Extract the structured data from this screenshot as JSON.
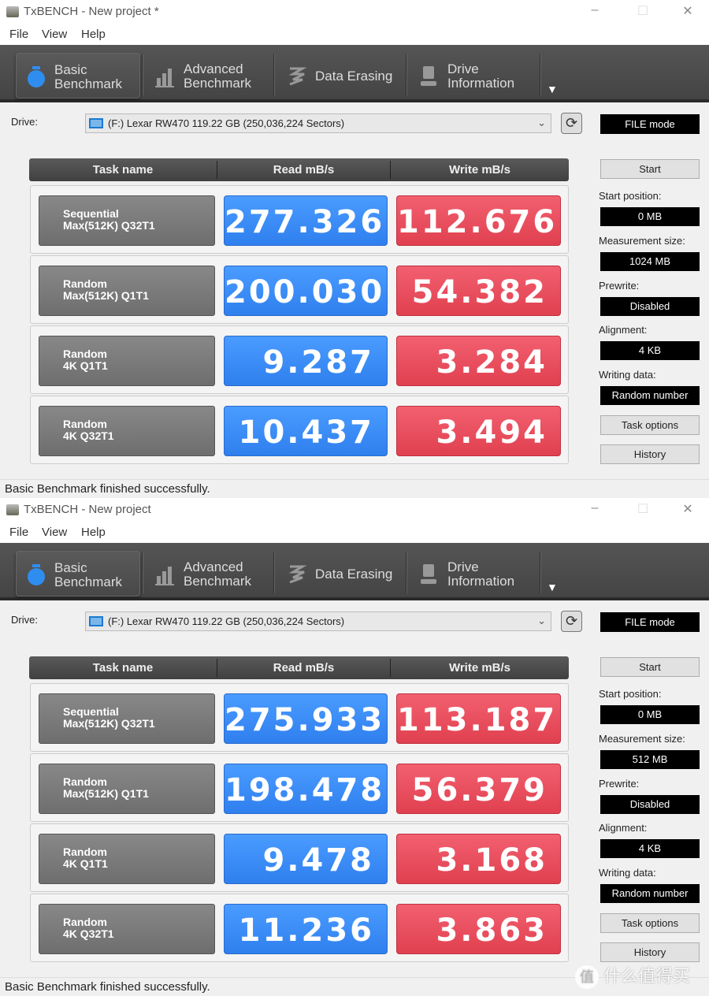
{
  "menu": [
    "File",
    "View",
    "Help"
  ],
  "tabs": [
    {
      "label1": "Basic",
      "label2": "Benchmark",
      "icon": "stopwatch-icon"
    },
    {
      "label1": "Advanced",
      "label2": "Benchmark",
      "icon": "bar-chart-icon"
    },
    {
      "label1": "Data Erasing",
      "label2": "",
      "icon": "eraser-icon"
    },
    {
      "label1": "Drive",
      "label2": "Information",
      "icon": "drive-info-icon"
    }
  ],
  "colors": {
    "read": "#2f7fee",
    "write": "#e0404f"
  },
  "watermark": {
    "symbol": "值",
    "text": "什么值得买"
  },
  "windows": [
    {
      "title": "TxBENCH - New project *",
      "drive_label": "Drive:",
      "drive": "(F:) Lexar RW470  119.22 GB (250,036,224 Sectors)",
      "mode": "FILE mode",
      "headers": [
        "Task name",
        "Read mB/s",
        "Write mB/s"
      ],
      "rows": [
        {
          "task1": "Sequential",
          "task2": "Max(512K) Q32T1",
          "read": "277.326",
          "write": "112.676"
        },
        {
          "task1": "Random",
          "task2": "Max(512K) Q1T1",
          "read": "200.030",
          "write": "54.382"
        },
        {
          "task1": "Random",
          "task2": "4K Q1T1",
          "read": "9.287",
          "write": "3.284"
        },
        {
          "task1": "Random",
          "task2": "4K Q32T1",
          "read": "10.437",
          "write": "3.494"
        }
      ],
      "start": "Start",
      "settings": [
        {
          "label": "Start position:",
          "value": "0 MB"
        },
        {
          "label": "Measurement size:",
          "value": "1024 MB"
        },
        {
          "label": "Prewrite:",
          "value": "Disabled"
        },
        {
          "label": "Alignment:",
          "value": "4 KB"
        },
        {
          "label": "Writing data:",
          "value": "Random number"
        }
      ],
      "task_options": "Task options",
      "history": "History",
      "status": "Basic Benchmark finished successfully."
    },
    {
      "title": "TxBENCH - New project",
      "drive_label": "Drive:",
      "drive": "(F:) Lexar RW470  119.22 GB (250,036,224 Sectors)",
      "mode": "FILE mode",
      "headers": [
        "Task name",
        "Read mB/s",
        "Write mB/s"
      ],
      "rows": [
        {
          "task1": "Sequential",
          "task2": "Max(512K) Q32T1",
          "read": "275.933",
          "write": "113.187"
        },
        {
          "task1": "Random",
          "task2": "Max(512K) Q1T1",
          "read": "198.478",
          "write": "56.379"
        },
        {
          "task1": "Random",
          "task2": "4K Q1T1",
          "read": "9.478",
          "write": "3.168"
        },
        {
          "task1": "Random",
          "task2": "4K Q32T1",
          "read": "11.236",
          "write": "3.863"
        }
      ],
      "start": "Start",
      "settings": [
        {
          "label": "Start position:",
          "value": "0 MB"
        },
        {
          "label": "Measurement size:",
          "value": "512 MB"
        },
        {
          "label": "Prewrite:",
          "value": "Disabled"
        },
        {
          "label": "Alignment:",
          "value": "4 KB"
        },
        {
          "label": "Writing data:",
          "value": "Random number"
        }
      ],
      "task_options": "Task options",
      "history": "History",
      "status": "Basic Benchmark finished successfully."
    }
  ]
}
